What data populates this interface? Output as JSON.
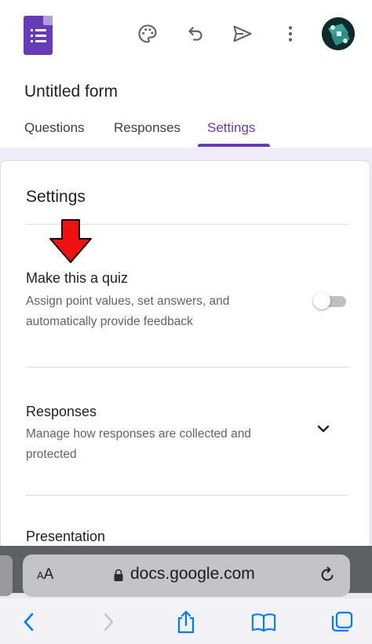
{
  "app": {
    "form_title": "Untitled form",
    "brand_color": "#673ab7"
  },
  "toolbar": {
    "icons": [
      "palette-icon",
      "undo-icon",
      "send-icon",
      "more-vert-icon"
    ]
  },
  "tabs": [
    {
      "label": "Questions",
      "active": false
    },
    {
      "label": "Responses",
      "active": false
    },
    {
      "label": "Settings",
      "active": true
    }
  ],
  "settings": {
    "heading": "Settings",
    "sections": [
      {
        "title": "Make this a quiz",
        "description": "Assign point values, set answers, and automatically provide feedback",
        "control": "toggle",
        "enabled": false
      },
      {
        "title": "Responses",
        "description": "Manage how responses are collected and protected",
        "control": "expand"
      },
      {
        "title": "Presentation"
      }
    ]
  },
  "browser": {
    "text_size_label_small": "A",
    "text_size_label_large": "A",
    "url": "docs.google.com",
    "accent_color": "#007aff"
  }
}
